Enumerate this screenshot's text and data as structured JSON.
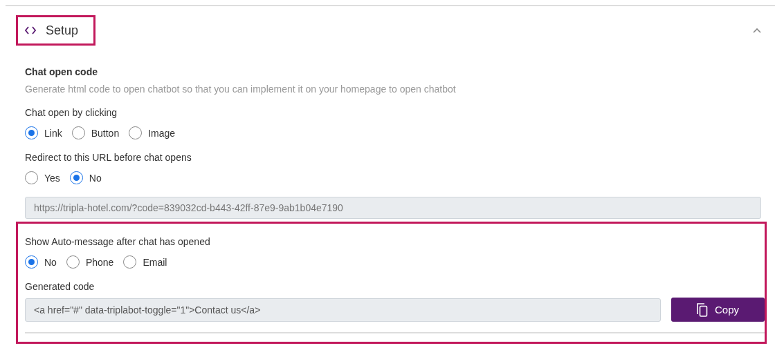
{
  "section": {
    "title": "Setup",
    "expanded": true,
    "highlighted": true
  },
  "chat_open_code": {
    "heading": "Chat open code",
    "description": "Generate html code to open chatbot so that you can implement it on your homepage to open chatbot"
  },
  "open_by": {
    "label": "Chat open by clicking",
    "options": [
      {
        "label": "Link",
        "selected": true
      },
      {
        "label": "Button",
        "selected": false
      },
      {
        "label": "Image",
        "selected": false
      }
    ]
  },
  "redirect": {
    "label": "Redirect to this URL before chat opens",
    "options": [
      {
        "label": "Yes",
        "selected": false
      },
      {
        "label": "No",
        "selected": true
      }
    ],
    "url": "https://tripla-hotel.com/?code=839032cd-b443-42ff-87e9-9ab1b04e7190"
  },
  "auto_message": {
    "highlighted": true,
    "label": "Show Auto-message after chat has opened",
    "options": [
      {
        "label": "No",
        "selected": true
      },
      {
        "label": "Phone",
        "selected": false
      },
      {
        "label": "Email",
        "selected": false
      }
    ]
  },
  "generated_code": {
    "label": "Generated code",
    "value": "<a href=\"#\" data-triplabot-toggle=\"1\">Contact us</a>",
    "copy_button": "Copy"
  }
}
